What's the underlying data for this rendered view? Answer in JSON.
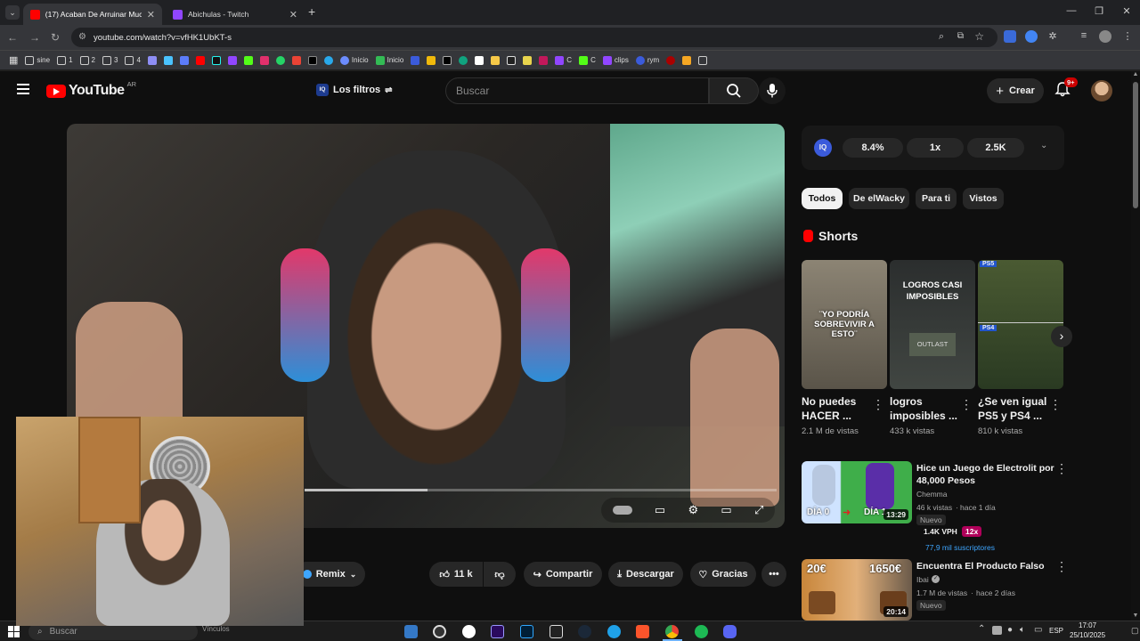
{
  "browser": {
    "tabs": [
      {
        "title": "(17) Acaban De Arruinar Mucha",
        "active": true,
        "color": "#ff0000"
      },
      {
        "title": "Abichulas - Twitch",
        "active": false,
        "color": "#9146ff"
      }
    ],
    "url": "youtube.com/watch?v=vfHK1UbKT-s",
    "bookmarks": [
      {
        "label": "sine",
        "kind": "folder"
      },
      {
        "label": "1",
        "kind": "folder"
      },
      {
        "label": "2",
        "kind": "folder"
      },
      {
        "label": "3",
        "kind": "folder"
      },
      {
        "label": "4",
        "kind": "folder"
      },
      {
        "label": "Inicio",
        "kind": "link"
      },
      {
        "label": "Inicio",
        "kind": "link"
      },
      {
        "label": "C",
        "kind": "link"
      },
      {
        "label": "C",
        "kind": "link"
      },
      {
        "label": "clips",
        "kind": "link"
      },
      {
        "label": "rym",
        "kind": "link"
      }
    ]
  },
  "youtube": {
    "logo_text": "YouTube",
    "region": "AR",
    "filters_label": "Los filtros",
    "search_placeholder": "Buscar",
    "create_label": "Crear",
    "notif_count": "9+"
  },
  "stats_bar": {
    "brand": "IQ",
    "pct": "8.4%",
    "speed": "1x",
    "count": "2.5K"
  },
  "chips": [
    "Todos",
    "De elWacky",
    "Para ti",
    "Vistos"
  ],
  "shorts": {
    "heading": "Shorts",
    "items": [
      {
        "title_l1": "No puedes",
        "title_l2": "HACER ...",
        "views": "2.1 M de vistas",
        "overlay_text": "¨YO PODRÍA SOBREVIVIR A ESTO¨"
      },
      {
        "title_l1": "logros",
        "title_l2": "imposibles ...",
        "views": "433 k vistas",
        "overlay_text": "LOGROS CASI IMPOSIBLES",
        "sub_text": "OUTLAST"
      },
      {
        "title_l1": "¿Se ven igual",
        "title_l2": "PS5 y PS4 ...",
        "views": "810 k vistas",
        "tag1": "PS5",
        "tag2": "PS4"
      }
    ]
  },
  "videos": [
    {
      "title_l1": "Hice un Juego de Electrolit por",
      "title_l2": "48,000 Pesos",
      "channel": "Chemma",
      "views": "46 k vistas",
      "age": "hace 1 día",
      "duration": "13:29",
      "badge": "Nuevo",
      "vph": "1.4K VPH",
      "mult": "12x",
      "subs": "77,9 mil suscriptores",
      "thumb_l": "DÍA 0",
      "thumb_r": "DÍA 1"
    },
    {
      "title_l1": "Encuentra El Producto Falso",
      "channel": "Ibai",
      "views": "1.7 M de vistas",
      "age": "hace 2 días",
      "duration": "20:14",
      "badge": "Nuevo",
      "price_l": "20€",
      "price_r": "1650€"
    }
  ],
  "actions": {
    "remix": "Remix",
    "likes": "11 k",
    "share": "Compartir",
    "download": "Descargar",
    "thanks": "Gracias"
  },
  "taskbar": {
    "search": "Buscar",
    "links": "Vínculos",
    "lang": "ESP",
    "time": "17:07",
    "date": "25/10/2025"
  }
}
